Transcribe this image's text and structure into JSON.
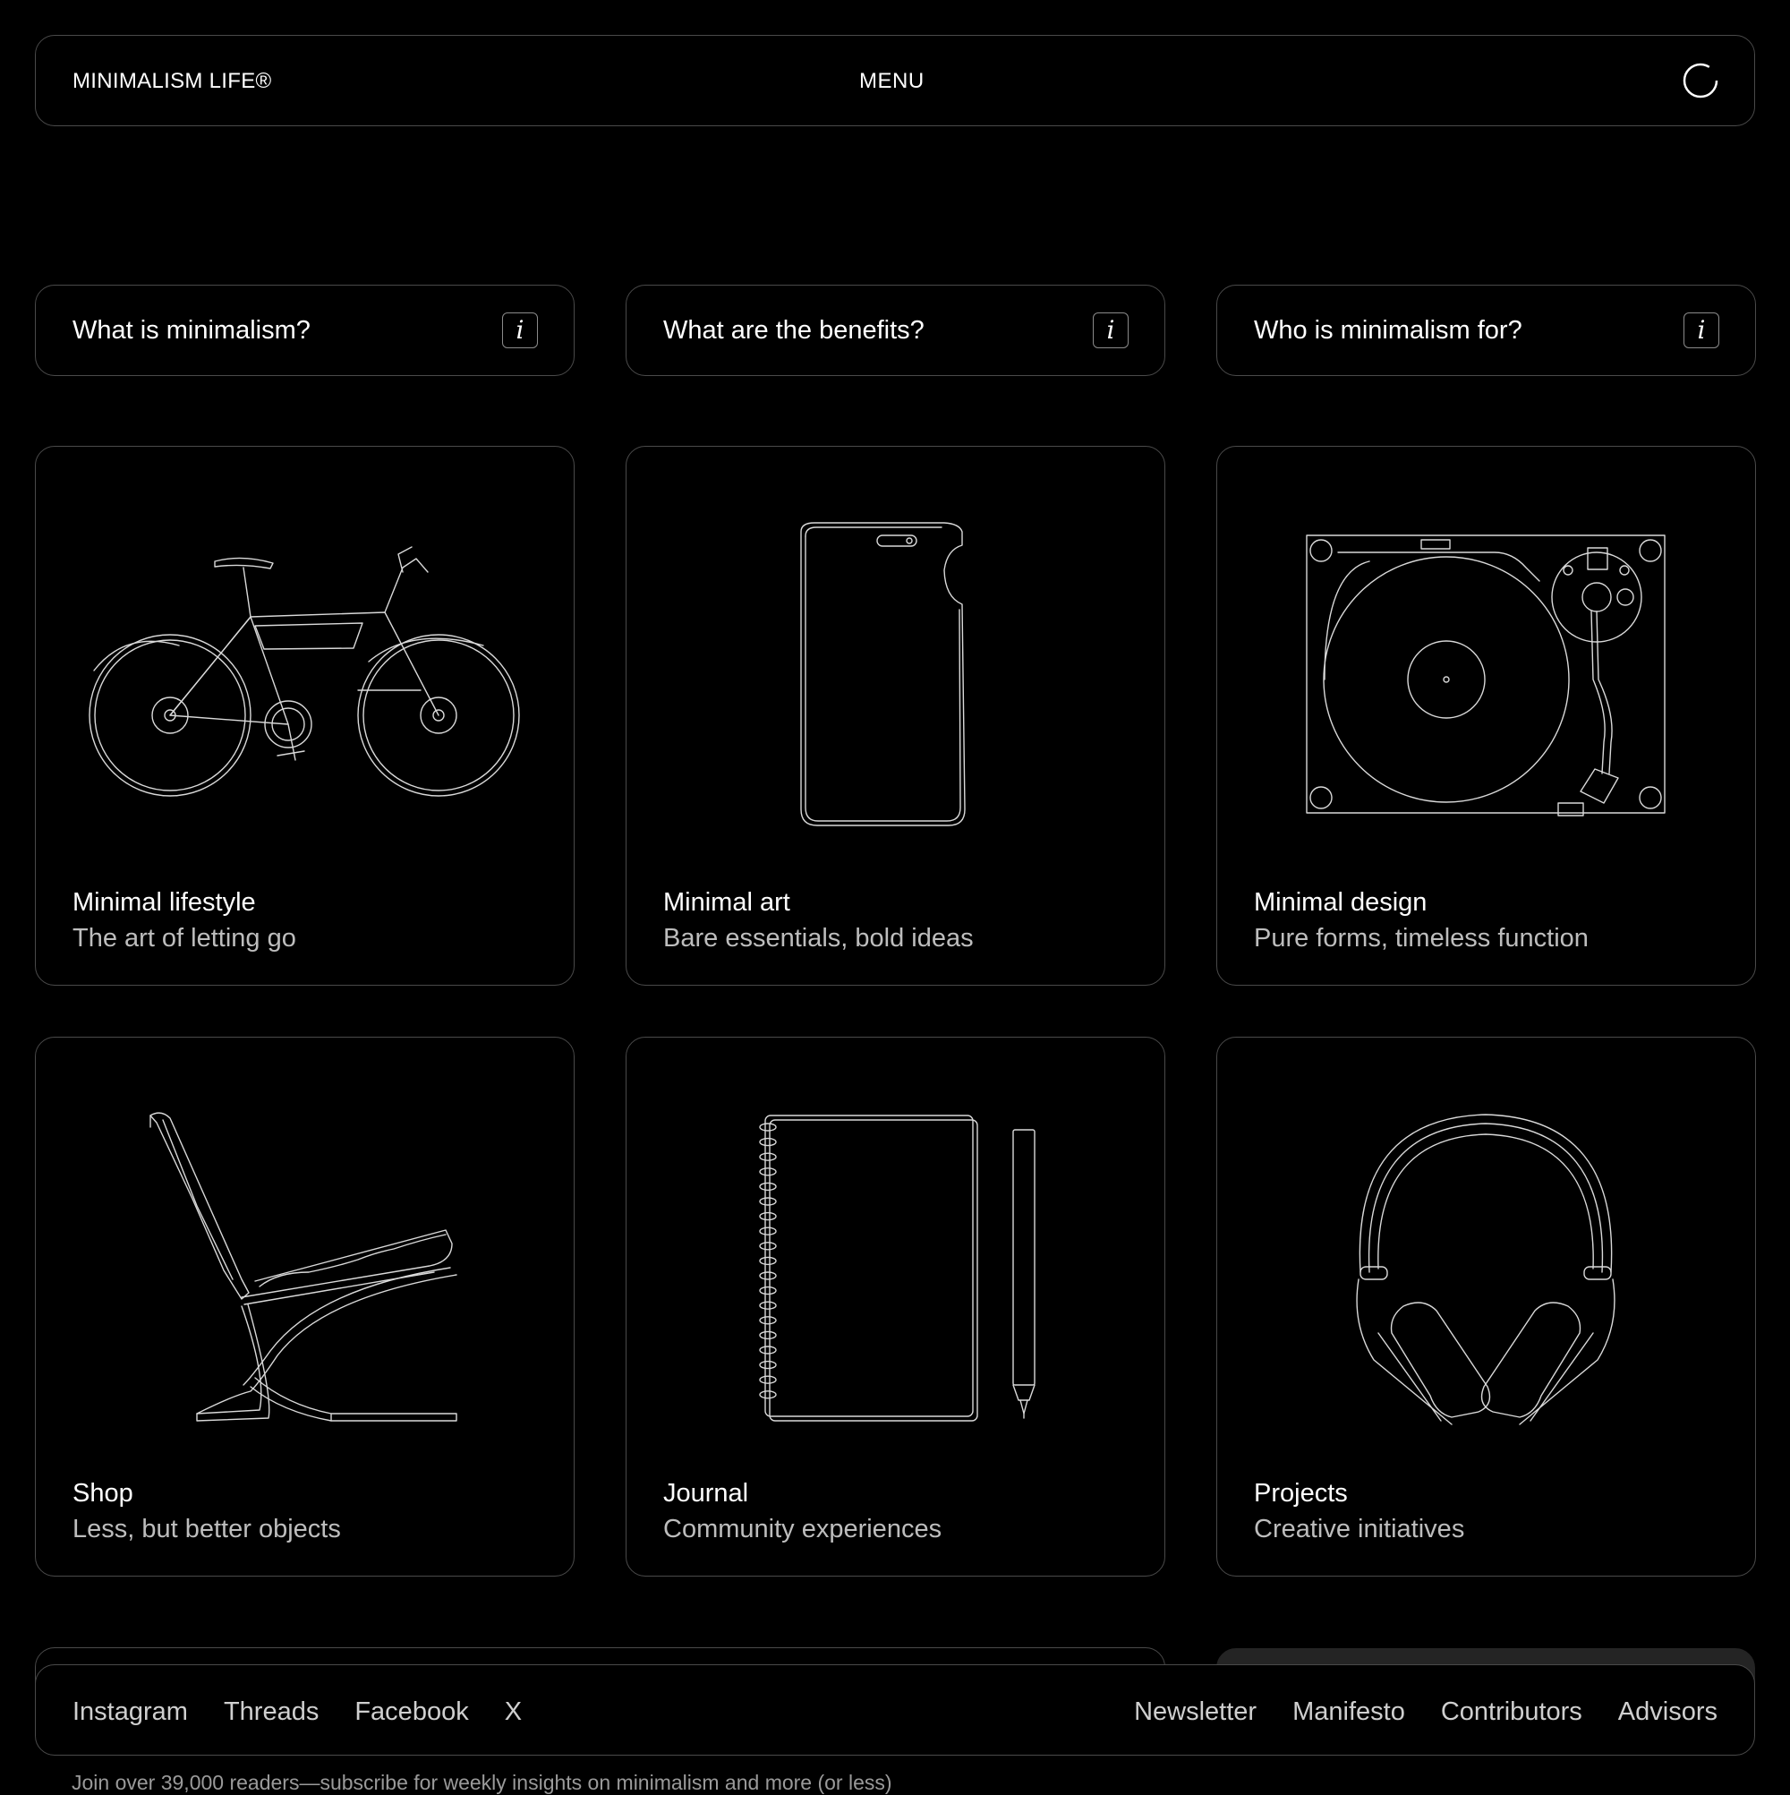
{
  "header": {
    "brand": "MINIMALISM LIFE®",
    "menu_label": "MENU",
    "loader_icon": "loading-ring-icon"
  },
  "faq": [
    {
      "label": "What is minimalism?",
      "icon": "info-icon",
      "icon_glyph": "i"
    },
    {
      "label": "What are the benefits?",
      "icon": "info-icon",
      "icon_glyph": "i"
    },
    {
      "label": "Who is minimalism for?",
      "icon": "info-icon",
      "icon_glyph": "i"
    }
  ],
  "cards": [
    {
      "title": "Minimal lifestyle",
      "subtitle": "The art of letting go",
      "illustration": "bicycle"
    },
    {
      "title": "Minimal art",
      "subtitle": "Bare essentials, bold ideas",
      "illustration": "smartphone"
    },
    {
      "title": "Minimal design",
      "subtitle": "Pure forms, timeless function",
      "illustration": "turntable"
    },
    {
      "title": "Shop",
      "subtitle": "Less, but better objects",
      "illustration": "lounge-chair"
    },
    {
      "title": "Journal",
      "subtitle": "Community experiences",
      "illustration": "notebook-and-pen"
    },
    {
      "title": "Projects",
      "subtitle": "Creative initiatives",
      "illustration": "headphones"
    }
  ],
  "footer": {
    "social_links": [
      "Instagram",
      "Threads",
      "Facebook",
      "X"
    ],
    "site_links": [
      "Newsletter",
      "Manifesto",
      "Contributors",
      "Advisors"
    ]
  },
  "tagline": "Join over 39,000 readers—subscribe for weekly insights on minimalism and more (or less)",
  "colors": {
    "background": "#000000",
    "border": "#4a4a4a",
    "text": "#ffffff",
    "muted_text": "#bdbdbd"
  }
}
